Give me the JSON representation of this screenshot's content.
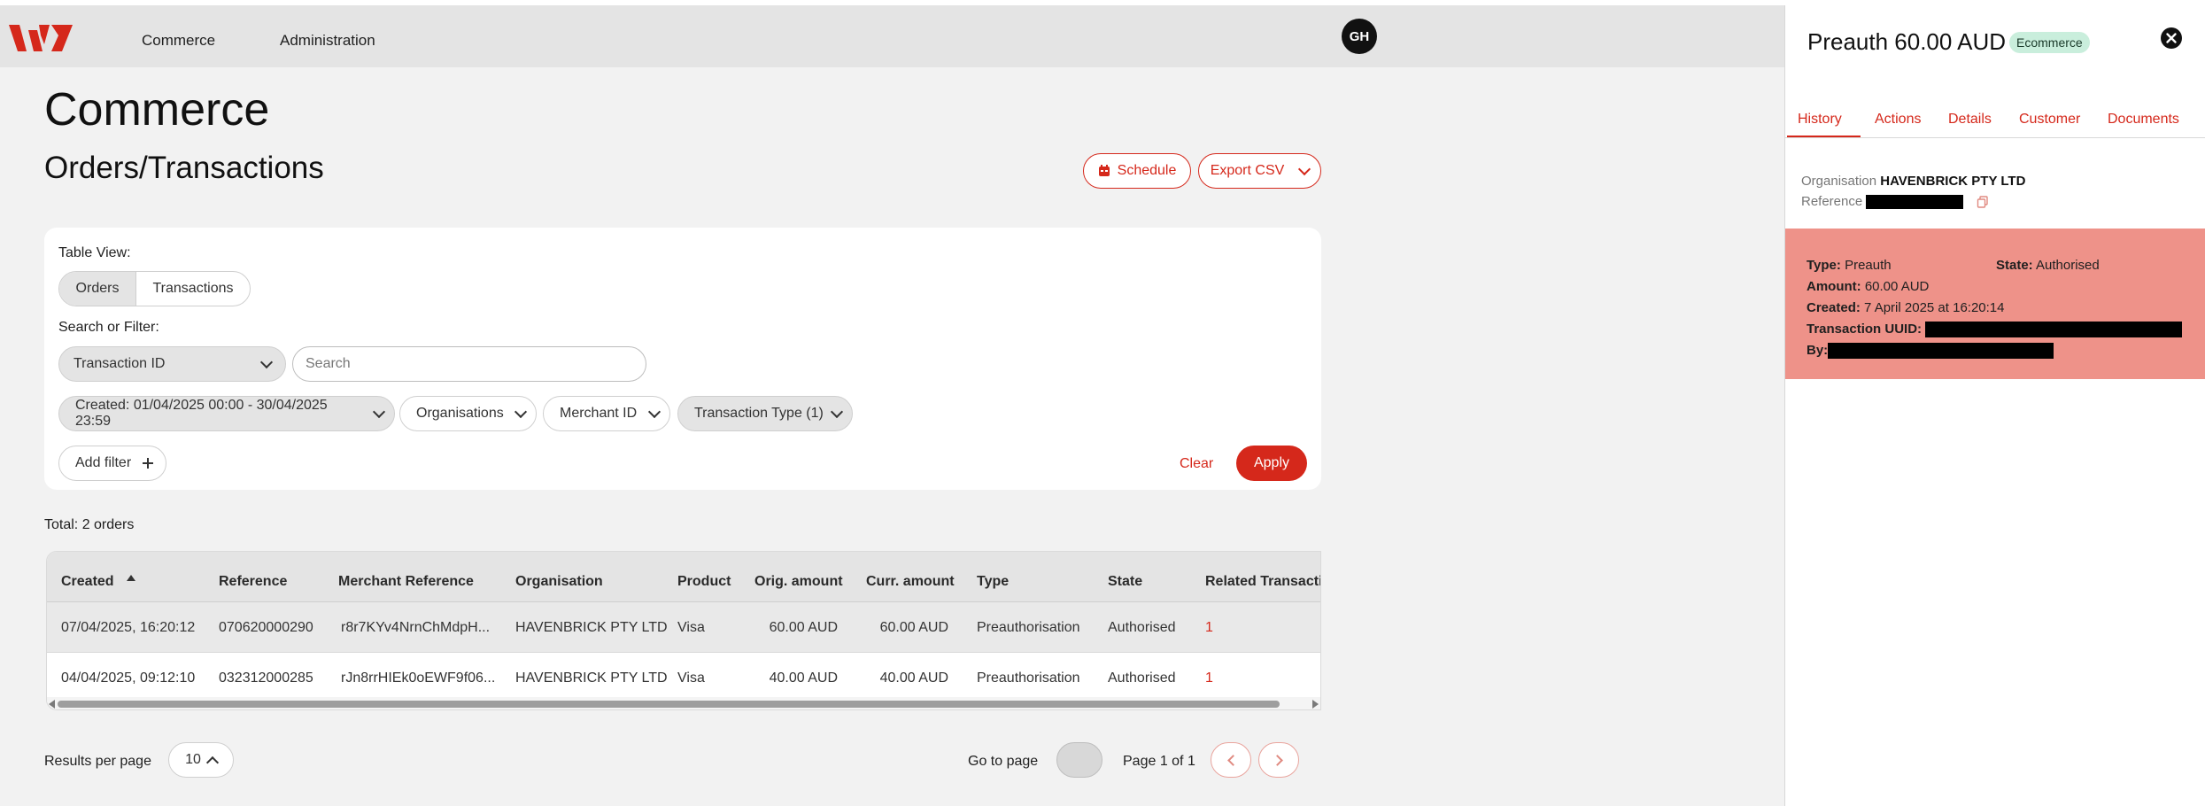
{
  "app": {
    "nav": {
      "items": [
        "Commerce",
        "Administration"
      ]
    },
    "avatar": {
      "initials": "GH"
    },
    "brand": {
      "accent": "#d5281b"
    }
  },
  "page": {
    "title": "Commerce",
    "section_title": "Orders/Transactions",
    "actions": {
      "schedule_label": "Schedule",
      "export_label": "Export CSV"
    }
  },
  "filters": {
    "table_view_label": "Table View:",
    "table_view_options": [
      "Orders",
      "Transactions"
    ],
    "table_view_selected": "Orders",
    "search_filter_label": "Search or Filter:",
    "field_select": "Transaction ID",
    "search_placeholder": "Search",
    "chips": [
      "Created: 01/04/2025 00:00 - 30/04/2025 23:59",
      "Organisations",
      "Merchant ID",
      "Transaction Type (1)"
    ],
    "add_filter_label": "Add filter",
    "add_filter_icon": "plus-icon",
    "clear_label": "Clear",
    "apply_label": "Apply"
  },
  "summary": {
    "total_text": "Total: 2 orders"
  },
  "table": {
    "columns": [
      "Created",
      "Reference",
      "Merchant Reference",
      "Organisation",
      "Product",
      "Orig. amount",
      "Curr. amount",
      "Type",
      "State",
      "Related Transactio"
    ],
    "sort": {
      "column": "Created",
      "direction": "ascending"
    },
    "rows": [
      [
        "07/04/2025, 16:20:12",
        "070620000290",
        "r8r7KYv4NrnChMdpH...",
        "HAVENBRICK PTY LTD",
        "Visa",
        "60.00 AUD",
        "60.00 AUD",
        "Preauthorisation",
        "Authorised",
        "1"
      ],
      [
        "04/04/2025, 09:12:10",
        "032312000285",
        "rJn8rrHIEk0oEWF9f06...",
        "HAVENBRICK PTY LTD",
        "Visa",
        "40.00 AUD",
        "40.00 AUD",
        "Preauthorisation",
        "Authorised",
        "1"
      ]
    ]
  },
  "pagination": {
    "results_per_page_label": "Results per page",
    "results_per_page": "10",
    "go_to_page_label": "Go to page",
    "page_info": "Page 1 of 1"
  },
  "panel": {
    "title": "Preauth 60.00 AUD",
    "badge": "Ecommerce",
    "badge_color": "#c9eedc",
    "tabs": [
      "History",
      "Actions",
      "Details",
      "Customer",
      "Documents"
    ],
    "active_tab": "History",
    "organisation_label": "Organisation",
    "organisation_value": "HAVENBRICK PTY LTD",
    "reference_label": "Reference",
    "event": {
      "background": "#ee9289",
      "type_label": "Type:",
      "type_value": "Preauth",
      "state_label": "State:",
      "state_value": "Authorised",
      "amount_label": "Amount:",
      "amount_value": "60.00 AUD",
      "created_label": "Created:",
      "created_value": "7 April 2025 at 16:20:14",
      "uuid_label": "Transaction UUID:",
      "by_label": "By:"
    }
  }
}
